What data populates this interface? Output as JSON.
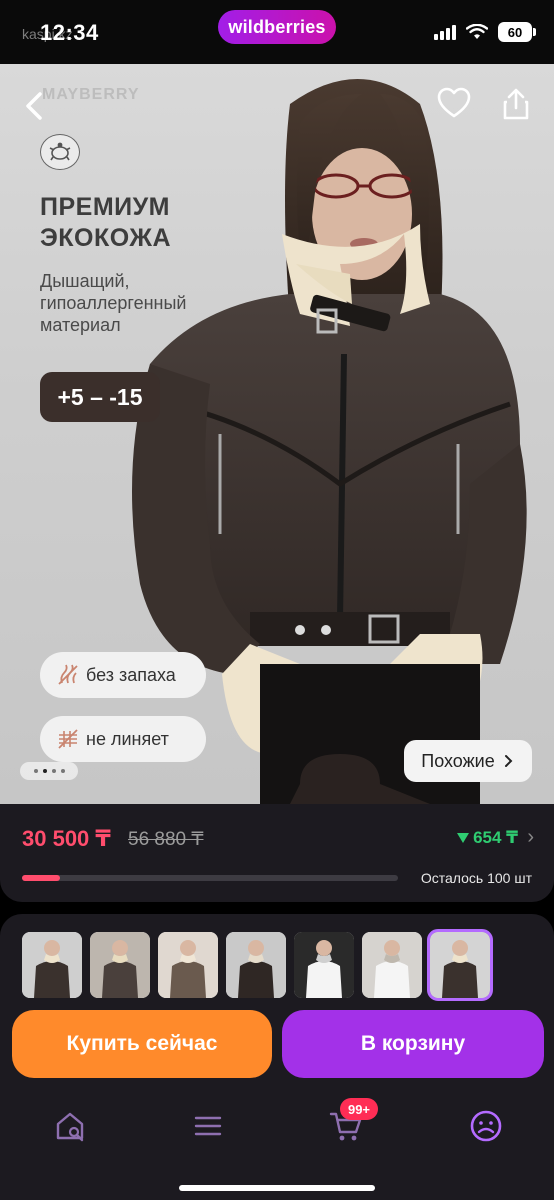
{
  "status_bar": {
    "time": "12:34",
    "carrier_mark": "kaspi.kz",
    "app_pill": "wildberries",
    "battery": "60"
  },
  "hero": {
    "brand": "MAYBERRY",
    "promo_title": "ПРЕМИУМ ЭКОКОЖА",
    "promo_subtitle": "Дышащий, гипоаллергенный материал",
    "temperature_badge": "+5 – -15",
    "features": [
      "без запаха",
      "не линяет"
    ],
    "similar_button": "Похожие",
    "carousel": {
      "total": 4,
      "active": 1
    }
  },
  "price": {
    "current": "30 500 ₸",
    "old": "56 880 ₸",
    "drop": "654 ₸",
    "stock_text": "Осталось 100 шт",
    "stock_progress": 0.1
  },
  "thumbnails_count": 7,
  "thumbnails_selected": 6,
  "actions": {
    "buy_now": "Купить сейчас",
    "add_to_cart": "В корзину"
  },
  "tabbar": {
    "items": [
      "home-search-icon",
      "catalog-icon",
      "cart-icon",
      "profile-icon"
    ],
    "cart_badge": "99+"
  },
  "colors": {
    "accent_purple": "#a331e8",
    "buy_orange": "#ff8a2b",
    "price_red": "#ff4d6d",
    "drop_green": "#2fcc71",
    "card_bg": "#1c1a20"
  }
}
